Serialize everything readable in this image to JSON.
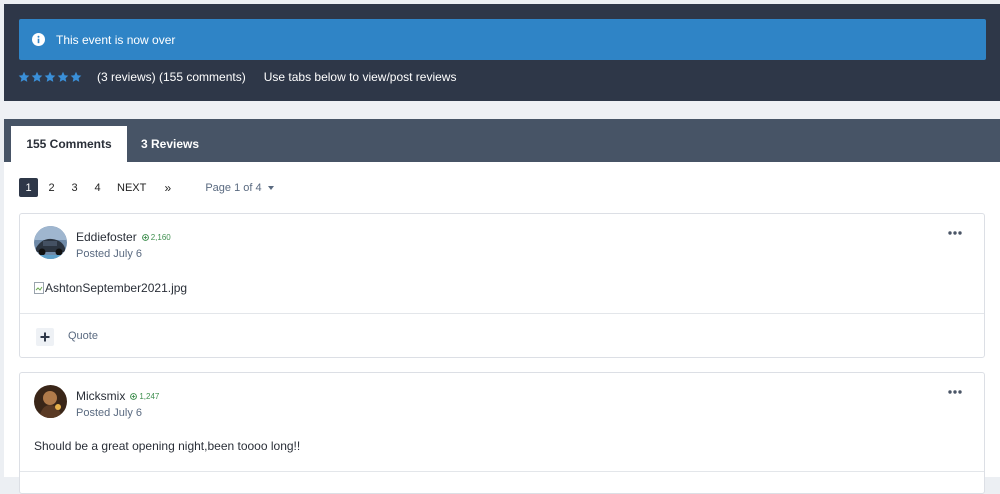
{
  "alert": {
    "text": "This event is now over",
    "icon": "info-icon"
  },
  "rating": {
    "stars": 5,
    "counts_text": "(3 reviews) (155 comments)",
    "hint_text": "Use tabs below to view/post reviews",
    "star_color": "#3a8fd8"
  },
  "tabs": [
    {
      "label": "155 Comments",
      "active": true
    },
    {
      "label": "3 Reviews",
      "active": false
    }
  ],
  "pagination": {
    "pages": [
      "1",
      "2",
      "3",
      "4"
    ],
    "current": "1",
    "next_label": "NEXT",
    "last_label": "»",
    "page_jump_label": "Page 1 of 4"
  },
  "posts": [
    {
      "author": "Eddiefoster",
      "reputation": "2,160",
      "posted": "Posted July 6",
      "attachment_alt": "AshtonSeptember2021.jpg",
      "quote_label": "Quote"
    },
    {
      "author": "Micksmix",
      "reputation": "1,247",
      "posted": "Posted July 6",
      "body": "Should be a great opening night,been toooo long!!"
    }
  ],
  "colors": {
    "header_bg": "#2e3748",
    "alert_bg": "#2f84c6",
    "tabbar_bg": "#475466",
    "reputation_green": "#3f8f4f"
  }
}
